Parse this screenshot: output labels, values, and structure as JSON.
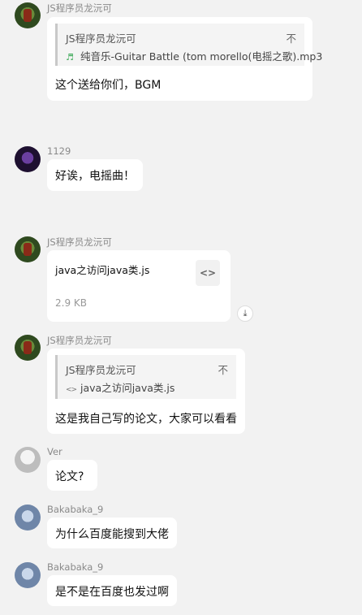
{
  "messages": [
    {
      "sender": "JS程序员龙沅可",
      "avatar": "avatar-green",
      "quote": {
        "name": "JS程序员龙沅可",
        "more": "不",
        "file_icon": "music-note-icon",
        "file": "纯音乐-Guitar Battle (tom morello(电摇之歌).mp3"
      },
      "text": "这个送给你们，BGM"
    },
    {
      "sender": "1129",
      "avatar": "avatar-purple",
      "text": "好诶，电摇曲！"
    },
    {
      "sender": "JS程序员龙沅可",
      "avatar": "avatar-green",
      "file": {
        "name": "java之访问java类.js",
        "size": "2.9 KB",
        "icon": "code-file-icon"
      }
    },
    {
      "sender": "JS程序员龙沅可",
      "avatar": "avatar-green",
      "quote": {
        "name": "JS程序员龙沅可",
        "more": "不",
        "file_icon": "code-file-icon",
        "file": "java之访问java类.js"
      },
      "text": "这是我自己写的论文，大家可以看看"
    },
    {
      "sender": "Ver",
      "avatar": "avatar-gray",
      "text": "论文?"
    },
    {
      "sender": "Bakabaka_9",
      "avatar": "avatar-blue",
      "text": "为什么百度能搜到大佬"
    },
    {
      "sender": "Bakabaka_9",
      "avatar": "avatar-blue",
      "text": "是不是在百度也发过啊"
    }
  ],
  "icons": {
    "download": "download-icon",
    "music_glyph": "♬",
    "code_glyph": "<>",
    "download_glyph": "⤓"
  }
}
